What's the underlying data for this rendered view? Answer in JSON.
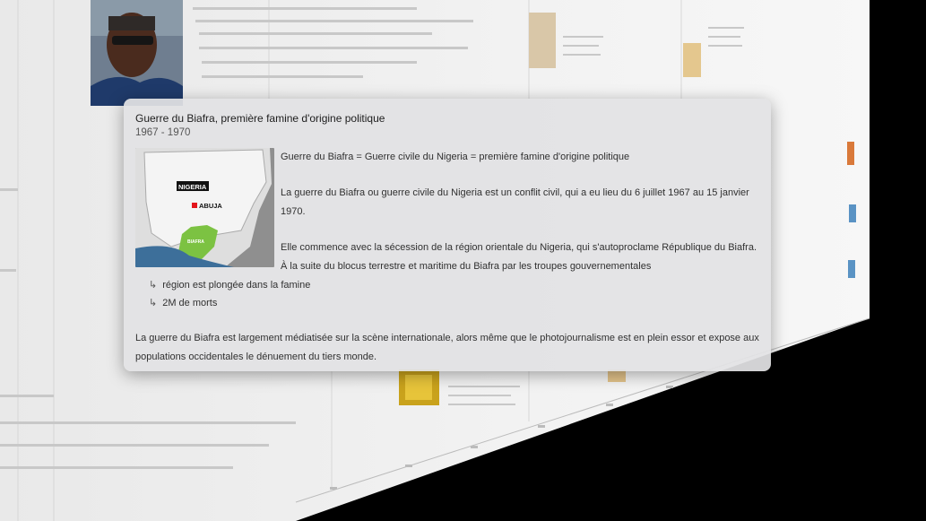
{
  "popup": {
    "title": "Guerre du Biafra, première famine d'origine politique",
    "date": "1967 - 1970",
    "map_labels": {
      "country": "NIGERIA",
      "capital": "ABUJA",
      "region": "BIAFRA"
    },
    "paragraphs": [
      "Guerre du Biafra = Guerre civile du Nigeria = première famine d'origine politique",
      "La guerre du Biafra ou guerre civile du Nigeria est un conflit civil, qui a eu lieu du 6 juillet 1967 au 15 janvier",
      "1970.",
      "Elle commence avec la sécession de la région orientale du Nigeria, qui s'autoproclame République du Biafra.",
      "À la suite du blocus terrestre et maritime du Biafra par les troupes gouvernementales"
    ],
    "consequences": [
      "région est plongée dans la famine",
      "2M de morts"
    ],
    "footer_lines": [
      "La guerre du Biafra est largement médiatisée sur la scène internationale, alors même que le photojournalisme est en plein essor et expose aux",
      "populations occidentales le dénuement du tiers monde."
    ]
  },
  "colors": {
    "card_bg": "#e2e2e4",
    "map_land": "#f2f2f2",
    "map_biafra": "#7cc242",
    "capital_marker": "#e3141b"
  }
}
